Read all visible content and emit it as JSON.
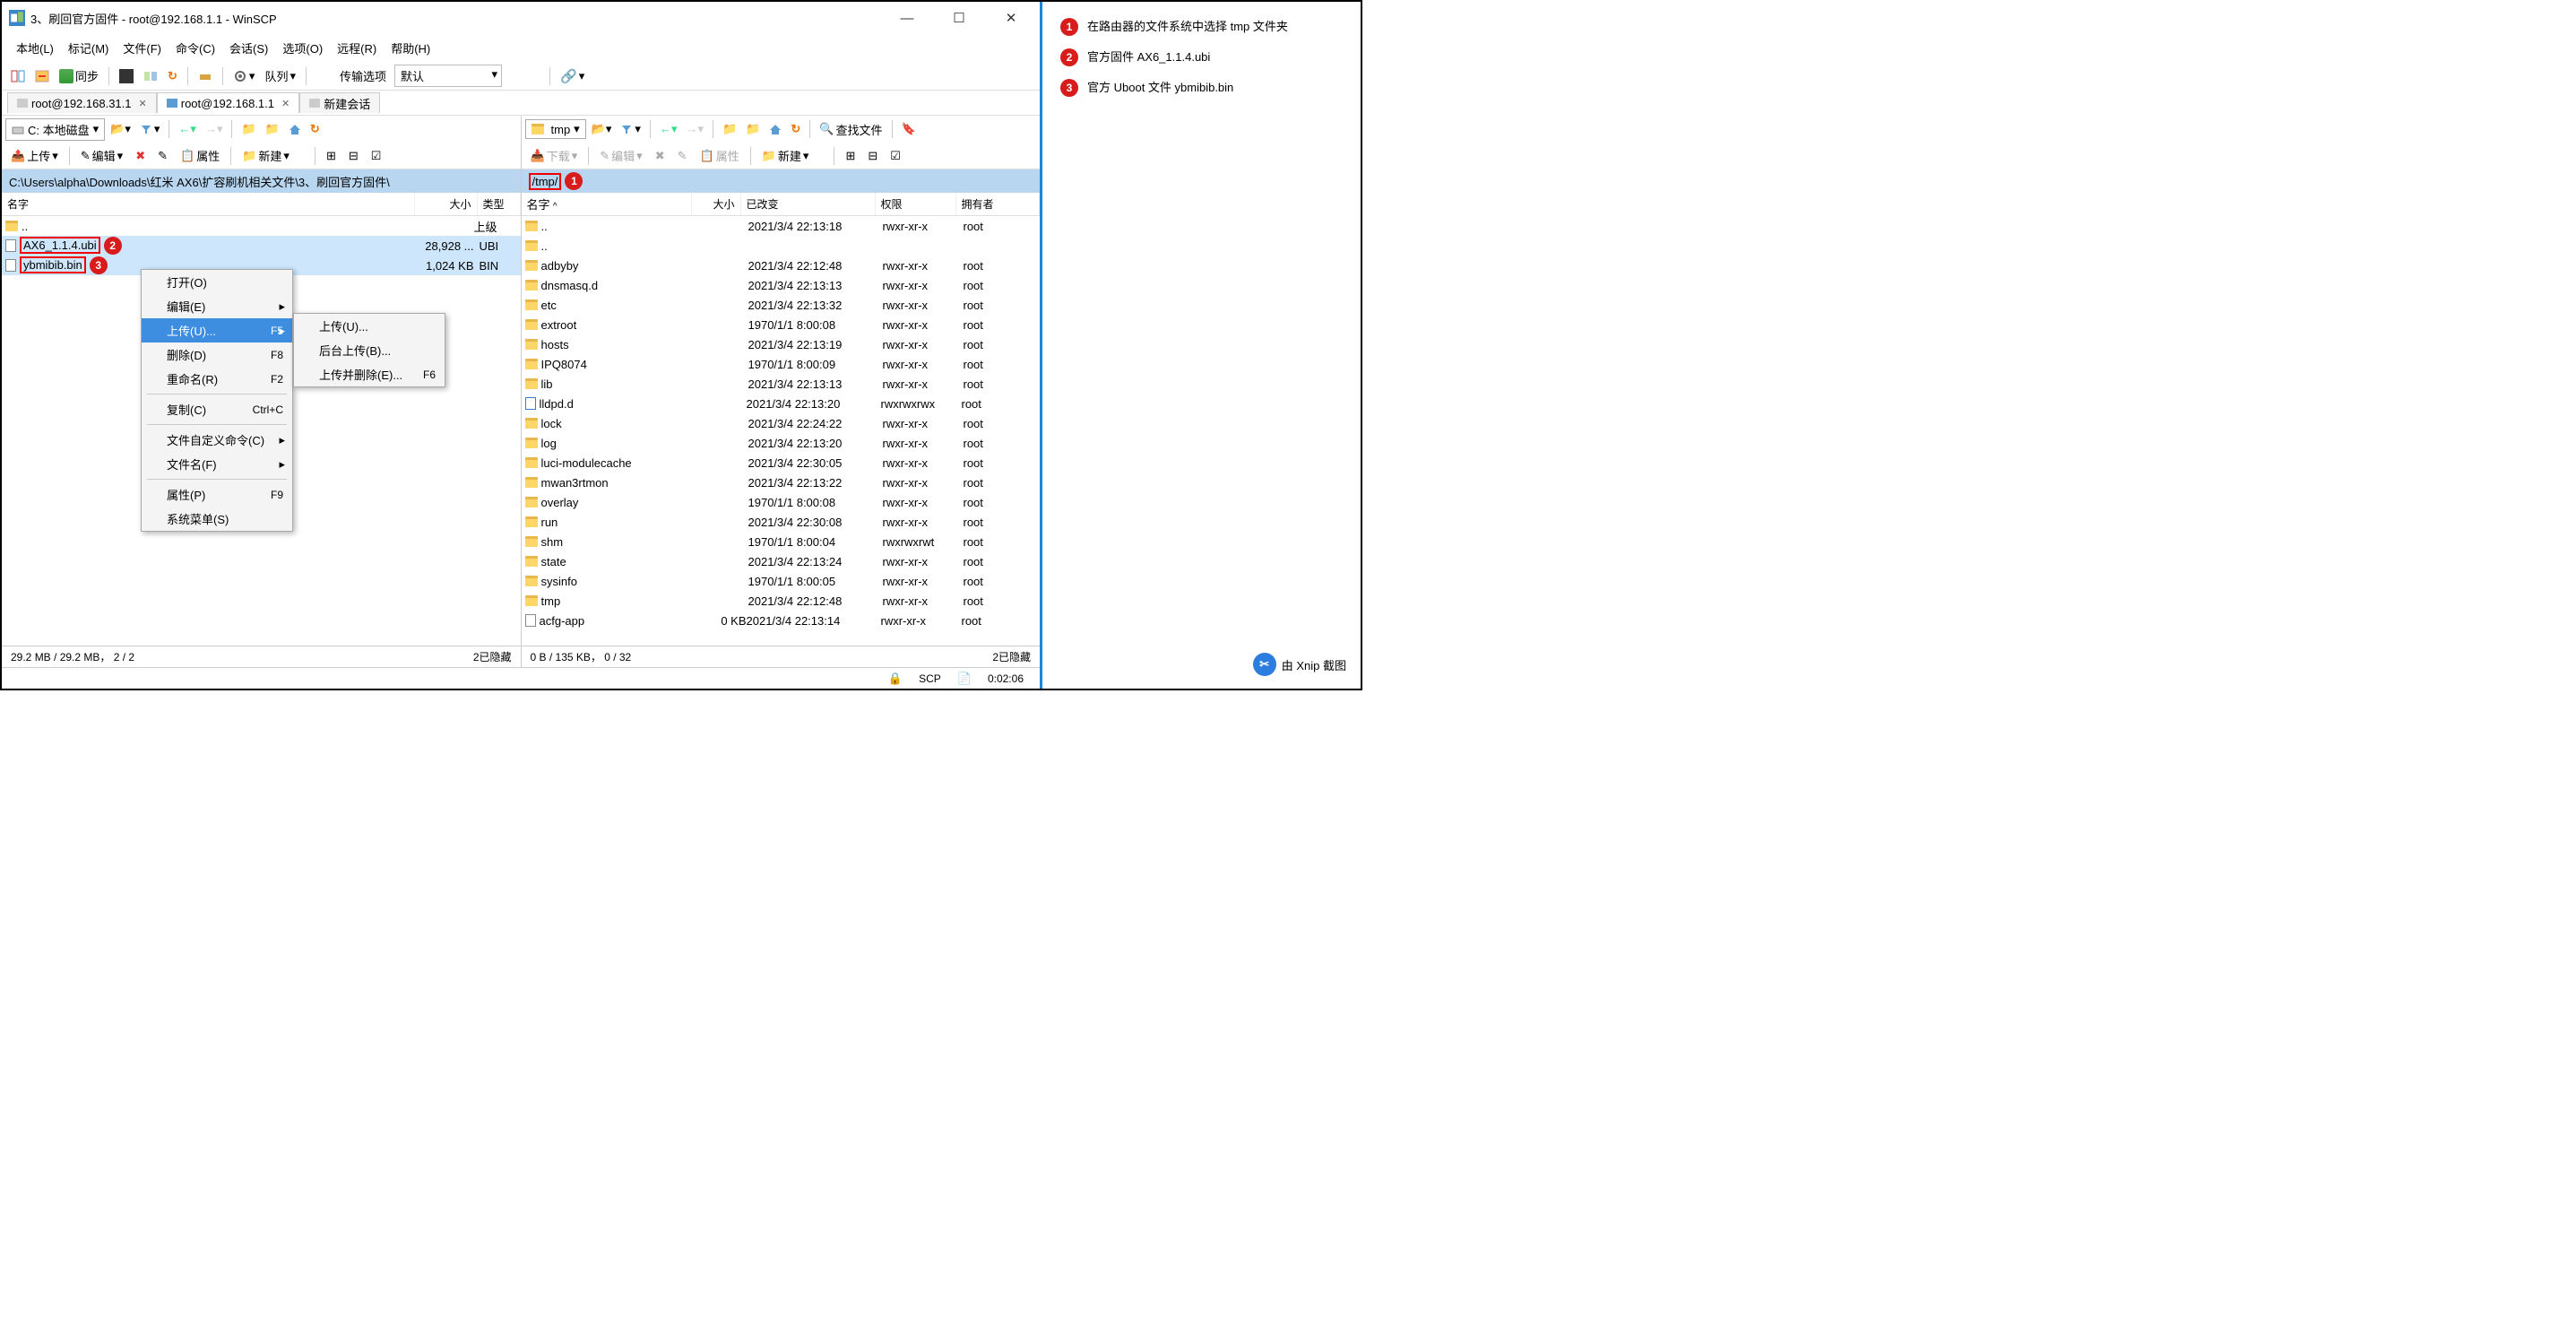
{
  "titlebar": {
    "text": "3、刷回官方固件 - root@192.168.1.1 - WinSCP"
  },
  "menubar": [
    "本地(L)",
    "标记(M)",
    "文件(F)",
    "命令(C)",
    "会话(S)",
    "选项(O)",
    "远程(R)",
    "帮助(H)"
  ],
  "toolbar_main": {
    "sync": "同步",
    "queue": "队列",
    "transfer_opts": "传输选项",
    "transfer_default": "默认"
  },
  "tabs": [
    {
      "label": "root@192.168.31.1",
      "active": false,
      "closeable": true
    },
    {
      "label": "root@192.168.1.1",
      "active": true,
      "closeable": true
    },
    {
      "label": "新建会话",
      "active": false,
      "closeable": false
    }
  ],
  "left": {
    "drive": "C: 本地磁盘",
    "ops": {
      "upload": "上传",
      "edit": "编辑",
      "props": "属性",
      "new": "新建"
    },
    "path": "C:\\Users\\alpha\\Downloads\\红米 AX6\\扩容刷机相关文件\\3、刷回官方固件\\",
    "cols": {
      "name": "名字",
      "size": "大小",
      "type": "类型"
    },
    "parent_type": "上级",
    "files": [
      {
        "name": "AX6_1.1.4.ubi",
        "size": "28,928 ...",
        "type": "UBI",
        "callout": "2",
        "sel": true,
        "boxed": true
      },
      {
        "name": "ybmibib.bin",
        "size": "1,024 KB",
        "type": "BIN",
        "callout": "3",
        "sel": true,
        "boxed": true
      }
    ],
    "status_left": "29.2 MB / 29.2 MB，  2 / 2",
    "status_right": "2已隐藏"
  },
  "right": {
    "drive": "tmp",
    "find": "查找文件",
    "ops": {
      "download": "下载",
      "edit": "编辑",
      "props": "属性",
      "new": "新建"
    },
    "path": "/tmp/",
    "callout": "1",
    "cols": {
      "name": "名字",
      "size": "大小",
      "changed": "已改变",
      "perms": "权限",
      "owner": "拥有者"
    },
    "files": [
      {
        "name": "..",
        "type": "up"
      },
      {
        "name": "adbyby",
        "type": "d",
        "changed": "2021/3/4 22:12:48",
        "perms": "rwxr-xr-x",
        "owner": "root"
      },
      {
        "name": "dnsmasq.d",
        "type": "d",
        "changed": "2021/3/4 22:13:13",
        "perms": "rwxr-xr-x",
        "owner": "root"
      },
      {
        "name": "etc",
        "type": "d",
        "changed": "2021/3/4 22:13:32",
        "perms": "rwxr-xr-x",
        "owner": "root"
      },
      {
        "name": "extroot",
        "type": "d",
        "changed": "1970/1/1 8:00:08",
        "perms": "rwxr-xr-x",
        "owner": "root"
      },
      {
        "name": "hosts",
        "type": "d",
        "changed": "2021/3/4 22:13:19",
        "perms": "rwxr-xr-x",
        "owner": "root"
      },
      {
        "name": "IPQ8074",
        "type": "d",
        "changed": "1970/1/1 8:00:09",
        "perms": "rwxr-xr-x",
        "owner": "root"
      },
      {
        "name": "lib",
        "type": "d",
        "changed": "2021/3/4 22:13:13",
        "perms": "rwxr-xr-x",
        "owner": "root"
      },
      {
        "name": "lldpd.d",
        "type": "l",
        "changed": "2021/3/4 22:13:20",
        "perms": "rwxrwxrwx",
        "owner": "root"
      },
      {
        "name": "lock",
        "type": "d",
        "changed": "2021/3/4 22:24:22",
        "perms": "rwxr-xr-x",
        "owner": "root"
      },
      {
        "name": "log",
        "type": "d",
        "changed": "2021/3/4 22:13:20",
        "perms": "rwxr-xr-x",
        "owner": "root"
      },
      {
        "name": "luci-modulecache",
        "type": "d",
        "changed": "2021/3/4 22:30:05",
        "perms": "rwxr-xr-x",
        "owner": "root"
      },
      {
        "name": "mwan3rtmon",
        "type": "d",
        "changed": "2021/3/4 22:13:22",
        "perms": "rwxr-xr-x",
        "owner": "root"
      },
      {
        "name": "overlay",
        "type": "d",
        "changed": "1970/1/1 8:00:08",
        "perms": "rwxr-xr-x",
        "owner": "root"
      },
      {
        "name": "run",
        "type": "d",
        "changed": "2021/3/4 22:30:08",
        "perms": "rwxr-xr-x",
        "owner": "root"
      },
      {
        "name": "shm",
        "type": "d",
        "changed": "1970/1/1 8:00:04",
        "perms": "rwxrwxrwt",
        "owner": "root"
      },
      {
        "name": "state",
        "type": "d",
        "changed": "2021/3/4 22:13:24",
        "perms": "rwxr-xr-x",
        "owner": "root"
      },
      {
        "name": "sysinfo",
        "type": "d",
        "changed": "1970/1/1 8:00:05",
        "perms": "rwxr-xr-x",
        "owner": "root"
      },
      {
        "name": "tmp",
        "type": "d",
        "changed": "2021/3/4 22:12:48",
        "perms": "rwxr-xr-x",
        "owner": "root"
      },
      {
        "name": "acfg-app",
        "type": "f",
        "size": "0 KB",
        "changed": "2021/3/4 22:13:14",
        "perms": "rwxr-xr-x",
        "owner": "root"
      }
    ],
    "up_changed": "2021/3/4 22:13:18",
    "up_perms": "rwxr-xr-x",
    "up_owner": "root",
    "status_left": "0 B / 135 KB，  0 / 32",
    "status_right": "2已隐藏"
  },
  "statusbar2": {
    "proto": "SCP",
    "time": "0:02:06"
  },
  "context_menu": {
    "items": [
      {
        "label": "打开(O)"
      },
      {
        "label": "编辑(E)",
        "arrow": true
      },
      {
        "label": "上传(U)...",
        "shortcut": "F5",
        "arrow": true,
        "highlight": true
      },
      {
        "label": "删除(D)",
        "shortcut": "F8"
      },
      {
        "label": "重命名(R)",
        "shortcut": "F2"
      },
      {
        "sep": true
      },
      {
        "label": "复制(C)",
        "shortcut": "Ctrl+C"
      },
      {
        "sep": true
      },
      {
        "label": "文件自定义命令(C)",
        "arrow": true
      },
      {
        "label": "文件名(F)",
        "arrow": true
      },
      {
        "sep": true
      },
      {
        "label": "属性(P)",
        "shortcut": "F9"
      },
      {
        "label": "系统菜单(S)"
      }
    ]
  },
  "submenu": {
    "items": [
      {
        "label": "上传(U)..."
      },
      {
        "label": "后台上传(B)..."
      },
      {
        "label": "上传并删除(E)...",
        "shortcut": "F6"
      }
    ]
  },
  "notes": [
    {
      "num": "1",
      "text": "在路由器的文件系统中选择 tmp 文件夹"
    },
    {
      "num": "2",
      "text": "官方固件 AX6_1.1.4.ubi"
    },
    {
      "num": "3",
      "text": "官方 Uboot 文件 ybmibib.bin"
    }
  ],
  "credit": "由 Xnip 截图"
}
